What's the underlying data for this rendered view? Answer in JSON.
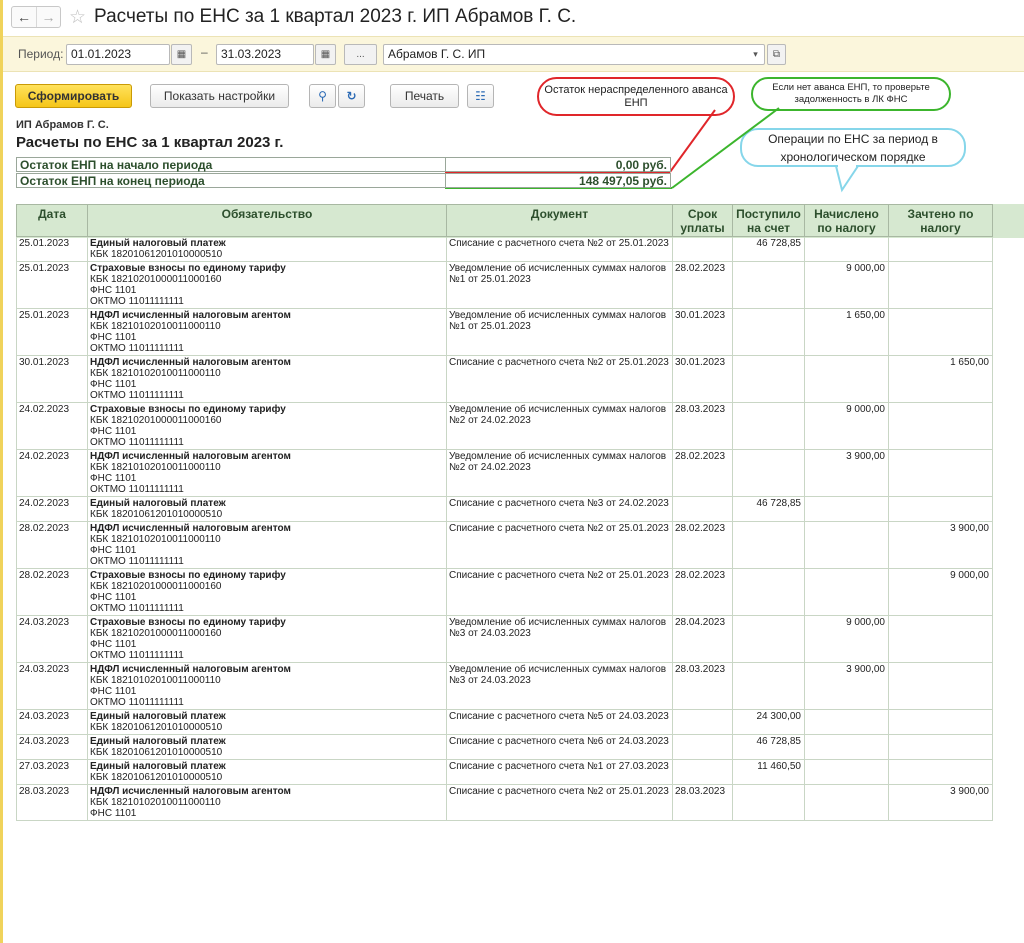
{
  "window": {
    "title": "Расчеты по ЕНС за 1 квартал 2023 г. ИП Абрамов Г. С."
  },
  "toolbar": {
    "period_label": "Период:",
    "date_from": "01.01.2023",
    "dash": "–",
    "date_to": "31.03.2023",
    "ellipsis": "...",
    "org": "Абрамов Г. С. ИП",
    "generate_label": "Сформировать",
    "settings_label": "Показать настройки",
    "print_label": "Печать"
  },
  "callouts": {
    "red": "Остаток нераспределенного аванса ЕНП",
    "green": "Если нет аванса ЕНП, то проверьте задолженность в ЛК ФНС",
    "cyan": "Операции по ЕНС за период в хронологическом порядке"
  },
  "colors": {
    "red": "#e0262a",
    "green": "#3cb52d",
    "cyan": "#86d6ea",
    "header_bg": "#d6e8d0",
    "accent": "#f5c518"
  },
  "report": {
    "org": "ИП Абрамов Г. С.",
    "title": "Расчеты по ЕНС за 1 квартал 2023 г.",
    "balance_start_label": "Остаток ЕНП на начало периода",
    "balance_start_value": "0,00 руб.",
    "balance_end_label": "Остаток ЕНП на конец периода",
    "balance_end_value": "148 497,05 руб."
  },
  "table": {
    "columns": [
      "Дата",
      "Обязательство",
      "Документ",
      "Срок уплаты",
      "Поступило на счет",
      "Начислено по налогу",
      "Зачтено по налогу"
    ],
    "rows": [
      {
        "date": "25.01.2023",
        "ob": [
          "Единый налоговый платеж",
          "КБК 18201061201010000510"
        ],
        "doc": "Списание с расчетного счета №2 от 25.01.2023",
        "due": "",
        "in": "46 728,85",
        "acc": "",
        "off": ""
      },
      {
        "date": "25.01.2023",
        "ob": [
          "Страховые взносы по единому тарифу",
          "КБК 18210201000011000160",
          "ФНС 1101",
          "ОКТМО 11011111111"
        ],
        "doc": "Уведомление об исчисленных суммах налогов №1 от 25.01.2023",
        "due": "28.02.2023",
        "in": "",
        "acc": "9 000,00",
        "off": ""
      },
      {
        "date": "25.01.2023",
        "ob": [
          "НДФЛ исчисленный налоговым агентом",
          "КБК 18210102010011000110",
          "ФНС 1101",
          "ОКТМО 11011111111"
        ],
        "doc": "Уведомление об исчисленных суммах налогов №1 от 25.01.2023",
        "due": "30.01.2023",
        "in": "",
        "acc": "1 650,00",
        "off": ""
      },
      {
        "date": "30.01.2023",
        "ob": [
          "НДФЛ исчисленный налоговым агентом",
          "КБК 18210102010011000110",
          "ФНС 1101",
          "ОКТМО 11011111111"
        ],
        "doc": "Списание с расчетного счета №2 от 25.01.2023",
        "due": "30.01.2023",
        "in": "",
        "acc": "",
        "off": "1 650,00"
      },
      {
        "date": "24.02.2023",
        "ob": [
          "Страховые взносы по единому тарифу",
          "КБК 18210201000011000160",
          "ФНС 1101",
          "ОКТМО 11011111111"
        ],
        "doc": "Уведомление об исчисленных суммах налогов №2 от 24.02.2023",
        "due": "28.03.2023",
        "in": "",
        "acc": "9 000,00",
        "off": ""
      },
      {
        "date": "24.02.2023",
        "ob": [
          "НДФЛ исчисленный налоговым агентом",
          "КБК 18210102010011000110",
          "ФНС 1101",
          "ОКТМО 11011111111"
        ],
        "doc": "Уведомление об исчисленных суммах налогов №2 от 24.02.2023",
        "due": "28.02.2023",
        "in": "",
        "acc": "3 900,00",
        "off": ""
      },
      {
        "date": "24.02.2023",
        "ob": [
          "Единый налоговый платеж",
          "КБК 18201061201010000510"
        ],
        "doc": "Списание с расчетного счета №3 от 24.02.2023",
        "due": "",
        "in": "46 728,85",
        "acc": "",
        "off": ""
      },
      {
        "date": "28.02.2023",
        "ob": [
          "НДФЛ исчисленный налоговым агентом",
          "КБК 18210102010011000110",
          "ФНС 1101",
          "ОКТМО 11011111111"
        ],
        "doc": "Списание с расчетного счета №2 от 25.01.2023",
        "due": "28.02.2023",
        "in": "",
        "acc": "",
        "off": "3 900,00"
      },
      {
        "date": "28.02.2023",
        "ob": [
          "Страховые взносы по единому тарифу",
          "КБК 18210201000011000160",
          "ФНС 1101",
          "ОКТМО 11011111111"
        ],
        "doc": "Списание с расчетного счета №2 от 25.01.2023",
        "due": "28.02.2023",
        "in": "",
        "acc": "",
        "off": "9 000,00"
      },
      {
        "date": "24.03.2023",
        "ob": [
          "Страховые взносы по единому тарифу",
          "КБК 18210201000011000160",
          "ФНС 1101",
          "ОКТМО 11011111111"
        ],
        "doc": "Уведомление об исчисленных суммах налогов №3 от 24.03.2023",
        "due": "28.04.2023",
        "in": "",
        "acc": "9 000,00",
        "off": ""
      },
      {
        "date": "24.03.2023",
        "ob": [
          "НДФЛ исчисленный налоговым агентом",
          "КБК 18210102010011000110",
          "ФНС 1101",
          "ОКТМО 11011111111"
        ],
        "doc": "Уведомление об исчисленных суммах налогов №3 от 24.03.2023",
        "due": "28.03.2023",
        "in": "",
        "acc": "3 900,00",
        "off": ""
      },
      {
        "date": "24.03.2023",
        "ob": [
          "Единый налоговый платеж",
          "КБК 18201061201010000510"
        ],
        "doc": "Списание с расчетного счета №5 от 24.03.2023",
        "due": "",
        "in": "24 300,00",
        "acc": "",
        "off": ""
      },
      {
        "date": "24.03.2023",
        "ob": [
          "Единый налоговый платеж",
          "КБК 18201061201010000510"
        ],
        "doc": "Списание с расчетного счета №6 от 24.03.2023",
        "due": "",
        "in": "46 728,85",
        "acc": "",
        "off": ""
      },
      {
        "date": "27.03.2023",
        "ob": [
          "Единый налоговый платеж",
          "КБК 18201061201010000510"
        ],
        "doc": "Списание с расчетного счета №1 от 27.03.2023",
        "due": "",
        "in": "11 460,50",
        "acc": "",
        "off": ""
      },
      {
        "date": "28.03.2023",
        "ob": [
          "НДФЛ исчисленный налоговым агентом",
          "КБК 18210102010011000110",
          "ФНС 1101"
        ],
        "doc": "Списание с расчетного счета №2 от 25.01.2023",
        "due": "28.03.2023",
        "in": "",
        "acc": "",
        "off": "3 900,00"
      }
    ]
  }
}
